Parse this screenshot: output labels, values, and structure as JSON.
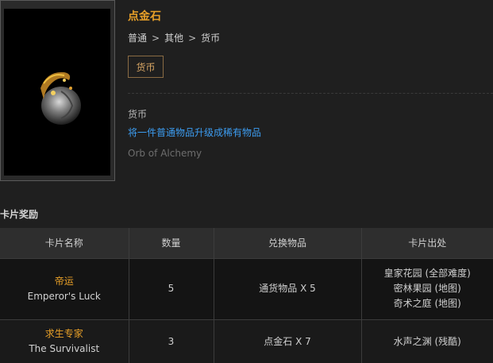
{
  "item": {
    "name": "点金石",
    "breadcrumb": [
      "普通",
      "其他",
      "货币"
    ],
    "tag": "货币",
    "type": "货币",
    "description": "将一件普通物品升级成稀有物品",
    "english_name": "Orb of Alchemy",
    "name_color": "#e8a028",
    "description_color": "#3c9cf0",
    "image_icon": "orb-of-alchemy-icon"
  },
  "cards_section": {
    "title": "卡片奖励",
    "headers": [
      "卡片名称",
      "数量",
      "兑换物品",
      "卡片出处"
    ],
    "rows": [
      {
        "name_cn": "帝运",
        "name_en": "Emperor's Luck",
        "quantity": "5",
        "reward": "通货物品 X 5",
        "sources": [
          "皇家花园 (全部难度)",
          "密林果园 (地图)",
          "奇术之庭 (地图)"
        ]
      },
      {
        "name_cn": "求生专家",
        "name_en": "The Survivalist",
        "quantity": "3",
        "reward": "点金石 X 7",
        "sources": [
          "水声之渊 (残酷)"
        ]
      }
    ]
  }
}
